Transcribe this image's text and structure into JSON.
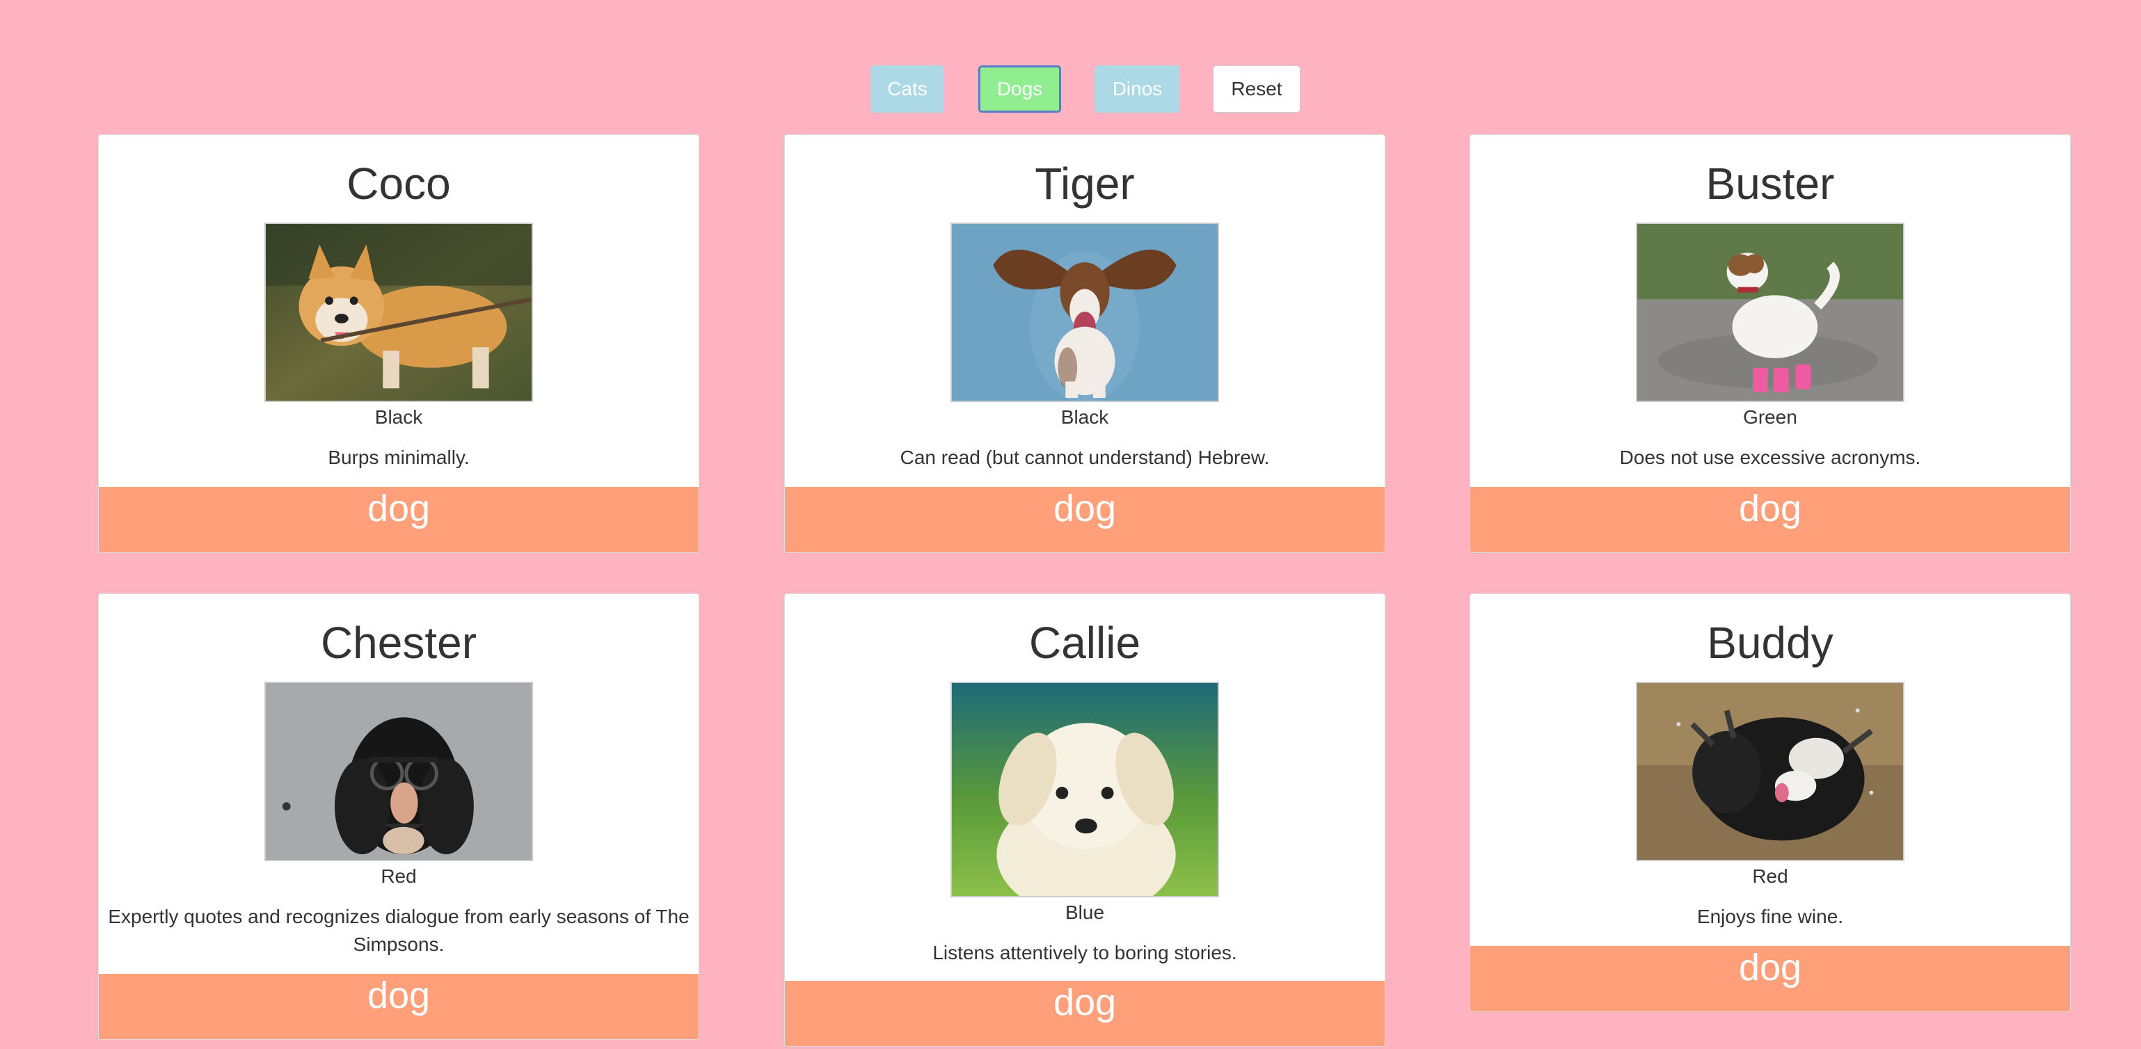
{
  "filters": {
    "cats_label": "Cats",
    "dogs_label": "Dogs",
    "dinos_label": "Dinos",
    "reset_label": "Reset"
  },
  "colors": {
    "background": "#ffb3c1",
    "filter_inactive": "#add8e6",
    "filter_active": "#90ee90",
    "type_bar": "#ffa07a"
  },
  "cards": [
    {
      "name": "Coco",
      "color": "Black",
      "description": "Burps minimally.",
      "type": "dog",
      "photo": "corgi-with-stick-image"
    },
    {
      "name": "Tiger",
      "color": "Black",
      "description": "Can read (but cannot understand) Hebrew.",
      "type": "dog",
      "photo": "basset-hound-flying-ears-image"
    },
    {
      "name": "Buster",
      "color": "Green",
      "description": "Does not use excessive acronyms.",
      "type": "dog",
      "photo": "jack-russell-pink-boots-image"
    },
    {
      "name": "Chester",
      "color": "Red",
      "description": "Expertly quotes and recognizes dialogue from early seasons of The Simpsons.",
      "type": "dog",
      "photo": "spaniel-groucho-glasses-image"
    },
    {
      "name": "Callie",
      "color": "Blue",
      "description": "Listens attentively to boring stories.",
      "type": "dog",
      "photo": "white-puppy-image"
    },
    {
      "name": "Buddy",
      "color": "Red",
      "description": "Enjoys fine wine.",
      "type": "dog",
      "photo": "wet-dog-shaking-image"
    }
  ]
}
